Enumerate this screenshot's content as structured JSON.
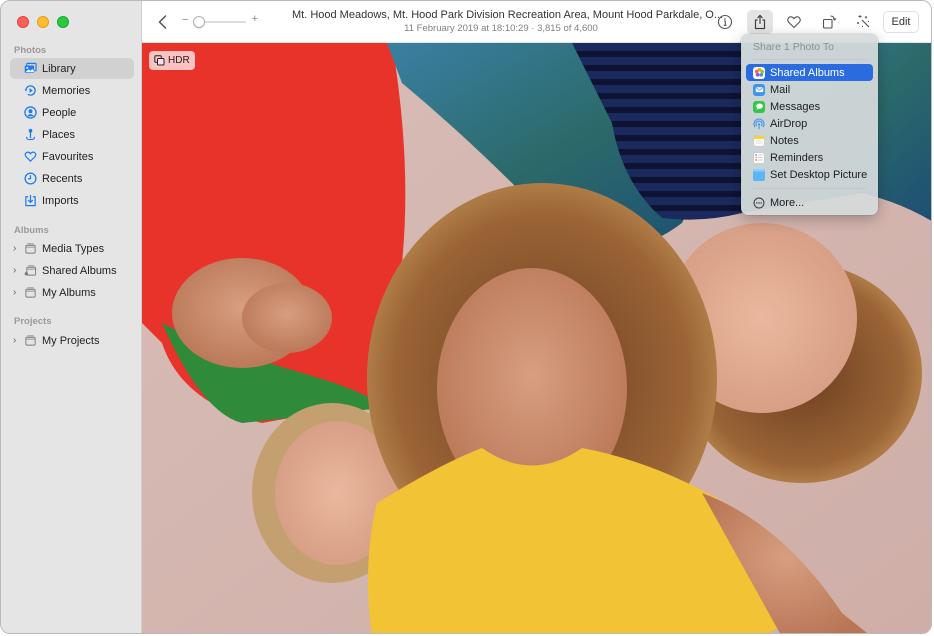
{
  "window": {
    "controls": [
      "close",
      "minimize",
      "maximize"
    ]
  },
  "sidebar": {
    "sections": [
      {
        "label": "Photos",
        "items": [
          {
            "label": "Library",
            "icon": "library-icon",
            "selected": true
          },
          {
            "label": "Memories",
            "icon": "memories-icon"
          },
          {
            "label": "People",
            "icon": "people-icon"
          },
          {
            "label": "Places",
            "icon": "places-icon"
          },
          {
            "label": "Favourites",
            "icon": "heart-icon"
          },
          {
            "label": "Recents",
            "icon": "clock-icon"
          },
          {
            "label": "Imports",
            "icon": "import-icon"
          }
        ]
      },
      {
        "label": "Albums",
        "items": [
          {
            "label": "Media Types",
            "icon": "folder-icon",
            "expandable": true
          },
          {
            "label": "Shared Albums",
            "icon": "shared-folder-icon",
            "expandable": true
          },
          {
            "label": "My Albums",
            "icon": "folder-icon",
            "expandable": true
          }
        ]
      },
      {
        "label": "Projects",
        "items": [
          {
            "label": "My Projects",
            "icon": "folder-icon",
            "expandable": true
          }
        ]
      }
    ]
  },
  "toolbar": {
    "back_icon": "chevron-left-icon",
    "zoom_slider": {
      "minus": "−",
      "plus": "+",
      "value": 0.1
    },
    "title": "Mt. Hood Meadows, Mt. Hood Park Division Recreation Area, Mount Hood Parkdale, O...",
    "subtitle": "11 February 2019 at 18:10:29  ·  3,815 of 4,600",
    "buttons": [
      {
        "name": "info",
        "icon": "info-icon"
      },
      {
        "name": "share",
        "icon": "share-icon",
        "active": true
      },
      {
        "name": "favourite",
        "icon": "heart-icon"
      },
      {
        "name": "rotate",
        "icon": "rotate-icon"
      },
      {
        "name": "auto-enhance",
        "icon": "magic-wand-icon"
      }
    ],
    "edit_label": "Edit"
  },
  "photo": {
    "badge": "HDR",
    "badge_icon": "live-photo-stack-icon"
  },
  "share_menu": {
    "header": "Share 1 Photo To",
    "items": [
      {
        "label": "Shared Albums",
        "icon": "photos-app-icon",
        "highlighted": true
      },
      {
        "label": "Mail",
        "icon": "mail-icon"
      },
      {
        "label": "Messages",
        "icon": "messages-icon"
      },
      {
        "label": "AirDrop",
        "icon": "airdrop-icon"
      },
      {
        "label": "Notes",
        "icon": "notes-icon"
      },
      {
        "label": "Reminders",
        "icon": "reminders-icon"
      },
      {
        "label": "Set Desktop Picture",
        "icon": "desktop-picture-icon"
      }
    ],
    "more_label": "More...",
    "more_icon": "ellipsis-circle-icon"
  },
  "colors": {
    "accent": "#2a6ce0",
    "sidebar_icon": "#1b7cf2",
    "close": "#fe5f57",
    "minimize": "#febc2e",
    "maximize": "#28c840"
  }
}
